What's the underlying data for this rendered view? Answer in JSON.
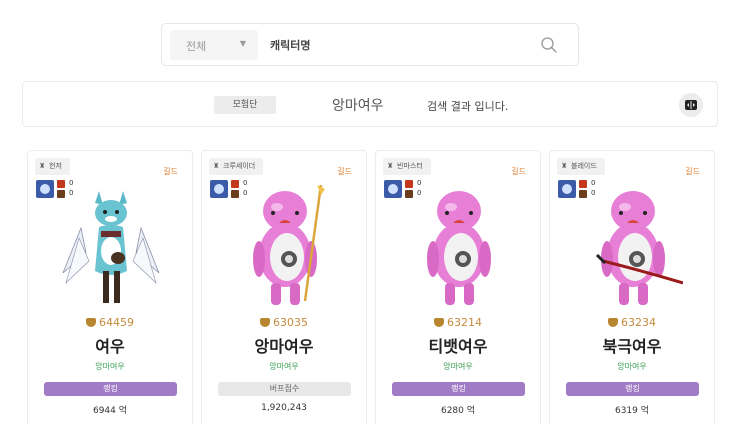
{
  "search": {
    "server_label": "전체",
    "placeholder": "캐릭터명",
    "icons": {
      "caret": "caret-down-icon",
      "search": "search-icon"
    }
  },
  "result": {
    "badge": "모험단",
    "query": "앙마여우",
    "suffix": "검색 결과 입니다.",
    "toggle_icon": "view-toggle-icon"
  },
  "colors": {
    "accent_purple": "#a17bc6",
    "fame_gold": "#c58a3c",
    "adventure_green": "#3a9c53",
    "guild_orange": "#e07b2a"
  },
  "cards": [
    {
      "job": "헌저",
      "guild": "길드",
      "gear1": "0",
      "gear2": "0",
      "fame": "64459",
      "name": "여우",
      "adventure": "앙마여우",
      "badge": "랭킹",
      "badge_style": "purple",
      "value": "6944 억",
      "figure": "winged-fox-character"
    },
    {
      "job": "크루세이더",
      "guild": "길드",
      "gear1": "0",
      "gear2": "0",
      "fame": "63035",
      "name": "앙마여우",
      "adventure": "앙마여우",
      "badge": "버프점수",
      "badge_style": "gray",
      "value": "1,920,243",
      "figure": "pink-mascot-with-staff"
    },
    {
      "job": "빈마스터",
      "guild": "길드",
      "gear1": "0",
      "gear2": "0",
      "fame": "63214",
      "name": "티뱃여우",
      "adventure": "앙마여우",
      "badge": "랭킹",
      "badge_style": "purple",
      "value": "6280 억",
      "figure": "pink-mascot"
    },
    {
      "job": "블레이드",
      "guild": "길드",
      "gear1": "0",
      "gear2": "0",
      "fame": "63234",
      "name": "북극여우",
      "adventure": "앙마여우",
      "badge": "랭킹",
      "badge_style": "purple",
      "value": "6319 억",
      "figure": "pink-mascot-with-sword"
    }
  ]
}
